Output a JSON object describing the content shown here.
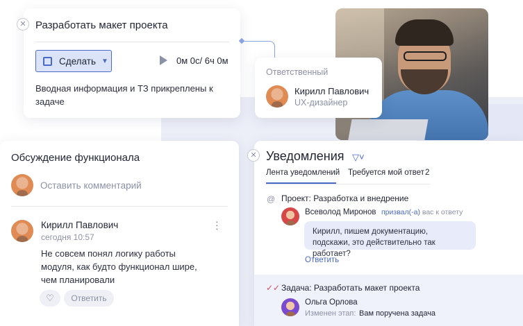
{
  "task": {
    "title": "Разработать макет проекта",
    "status_label": "Сделать",
    "timer": "0м 0с/ 6ч 0м",
    "description": "Вводная информация и ТЗ прикреплены к задаче"
  },
  "responsible": {
    "label": "Ответственный",
    "name": "Кирилл Павлович",
    "role": "UX-дизайнер"
  },
  "discussion": {
    "title": "Обсуждение функционала",
    "comment_placeholder": "Оставить комментарий",
    "message": {
      "author": "Кирилл Павлович",
      "time": "сегодня 10:57",
      "text": "Не совсем понял логику работы модуля, как будто функционал шире, чем планировали"
    },
    "reply_label": "Ответить"
  },
  "notifications": {
    "title": "Уведомления",
    "tabs": [
      {
        "label": "Лента уведомлений"
      },
      {
        "label": "Требуется мой ответ",
        "count": "2"
      }
    ],
    "items": [
      {
        "title": "Проект: Разработка и внедрение",
        "author": "Всеволод Миронов",
        "action_mention": "призвал(-а)",
        "action_rest": " вас к ответу",
        "message": "Кирилл, пишем документацию, подскажи, это действительно так работает?",
        "reply_label": "Ответить"
      },
      {
        "title": "Задача: Разработать макет проекта",
        "author": "Ольга Орлова",
        "stage_label": "Изменен этап:",
        "stage_value": "Вам поручена задача"
      }
    ]
  },
  "colors": {
    "accent": "#4a69c6",
    "accent_light": "#dbe3f8",
    "muted_text": "#8c92a6",
    "check_red": "#e0485a"
  }
}
